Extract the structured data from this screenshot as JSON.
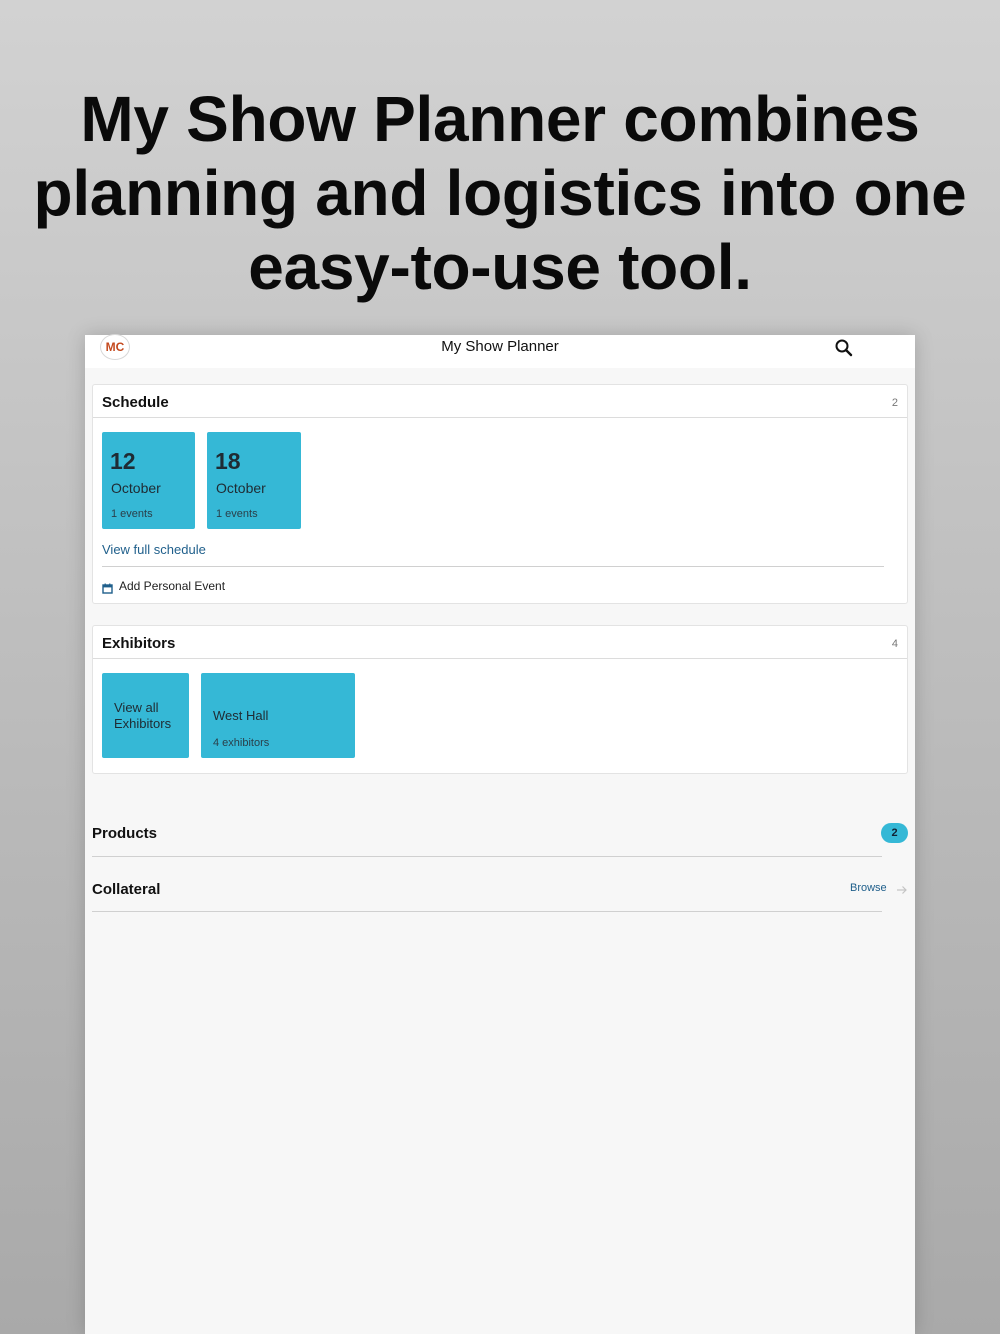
{
  "headline": "My Show Planner combines planning and logistics into one easy-to-use tool.",
  "navbar": {
    "avatar_initials": "MC",
    "title": "My Show Planner",
    "search_icon": "search-icon"
  },
  "schedule": {
    "title": "Schedule",
    "count": "2",
    "days": [
      {
        "day": "12",
        "month": "October",
        "events": "1 events"
      },
      {
        "day": "18",
        "month": "October",
        "events": "1 events"
      }
    ],
    "view_full_label": "View full schedule",
    "add_event_label": "Add Personal Event",
    "add_event_icon": "calendar-icon"
  },
  "exhibitors": {
    "title": "Exhibitors",
    "count": "4",
    "view_all_label": "View all Exhibitors",
    "halls": [
      {
        "name": "West Hall",
        "count": "4 exhibitors"
      }
    ]
  },
  "products": {
    "title": "Products",
    "badge": "2"
  },
  "collateral": {
    "title": "Collateral",
    "browse_label": "Browse",
    "browse_icon": "arrow-right-icon"
  },
  "colors": {
    "accent": "#35b8d6",
    "link": "#1f5f8b",
    "avatar_text": "#c44a1f"
  }
}
